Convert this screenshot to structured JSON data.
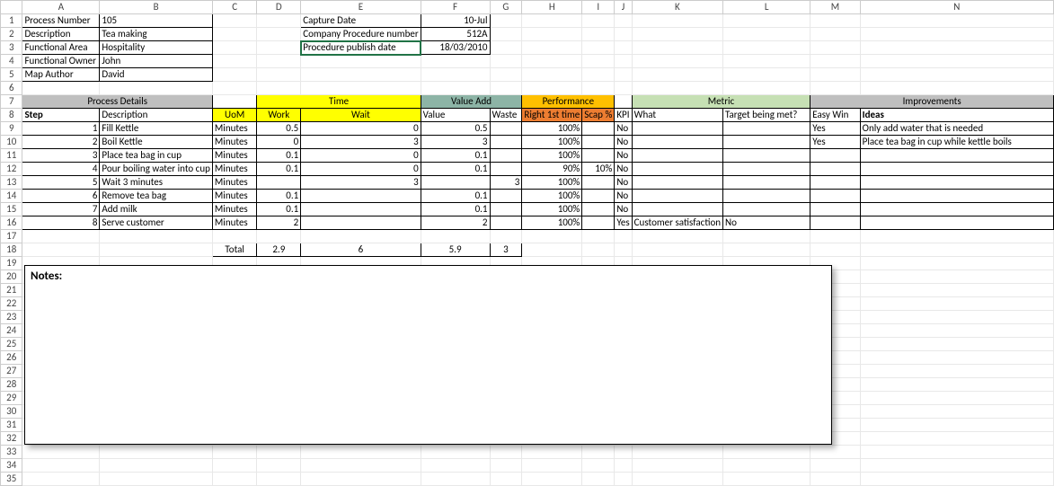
{
  "columns": [
    "A",
    "B",
    "C",
    "D",
    "E",
    "F",
    "G",
    "H",
    "I",
    "J",
    "K",
    "L",
    "M",
    "N"
  ],
  "rows": 35,
  "meta": {
    "process_number_label": "Process  Number",
    "process_number": "105",
    "description_label": "Description",
    "description": "Tea making",
    "functional_area_label": "Functional Area",
    "functional_area": "Hospitality",
    "functional_owner_label": "Functional Owner",
    "functional_owner": "John",
    "map_author_label": "Map Author",
    "map_author": "David",
    "capture_date_label": "Capture Date",
    "capture_date": "10-Jul",
    "company_proc_label": "Company Procedure number",
    "company_proc": "512A",
    "publish_label": "Procedure publish date",
    "publish": "18/03/2010"
  },
  "group_headers": {
    "process_details": "Process Details",
    "time": "Time",
    "value_add": "Value Add",
    "performance": "Performance",
    "metric": "Metric",
    "improvements": "Improvements"
  },
  "col_headers": {
    "step": "Step",
    "desc": "Description",
    "uom": "UoM",
    "work": "Work",
    "wait": "Wait",
    "value": "Value",
    "waste": "Waste",
    "right": "Right 1st time",
    "scap": "Scap %",
    "kpi": "KPI",
    "what": "What",
    "target": "Target being met?",
    "easy": "Easy Win",
    "ideas": "Ideas"
  },
  "steps": [
    {
      "n": "1",
      "desc": "Fill Kettle",
      "uom": "Minutes",
      "work": "0.5",
      "wait": "0",
      "value": "0.5",
      "waste": "",
      "right": "100%",
      "scap": "",
      "kpi": "No",
      "what": "",
      "target": "",
      "easy": "Yes",
      "ideas": "Only add water that is needed"
    },
    {
      "n": "2",
      "desc": "Boil Kettle",
      "uom": "Minutes",
      "work": "0",
      "wait": "3",
      "value": "3",
      "waste": "",
      "right": "100%",
      "scap": "",
      "kpi": "No",
      "what": "",
      "target": "",
      "easy": "Yes",
      "ideas": "Place tea bag in cup while kettle boils"
    },
    {
      "n": "3",
      "desc": "Place tea bag in cup",
      "uom": "Minutes",
      "work": "0.1",
      "wait": "0",
      "value": "0.1",
      "waste": "",
      "right": "100%",
      "scap": "",
      "kpi": "No",
      "what": "",
      "target": "",
      "easy": "",
      "ideas": ""
    },
    {
      "n": "4",
      "desc": "Pour boiling water into cup",
      "uom": "Minutes",
      "work": "0.1",
      "wait": "0",
      "value": "0.1",
      "waste": "",
      "right": "90%",
      "scap": "10%",
      "kpi": "No",
      "what": "",
      "target": "",
      "easy": "",
      "ideas": ""
    },
    {
      "n": "5",
      "desc": "Wait 3 minutes",
      "uom": "Minutes",
      "work": "",
      "wait": "3",
      "value": "",
      "waste": "3",
      "right": "100%",
      "scap": "",
      "kpi": "No",
      "what": "",
      "target": "",
      "easy": "",
      "ideas": ""
    },
    {
      "n": "6",
      "desc": "Remove tea bag",
      "uom": "Minutes",
      "work": "0.1",
      "wait": "",
      "value": "0.1",
      "waste": "",
      "right": "100%",
      "scap": "",
      "kpi": "No",
      "what": "",
      "target": "",
      "easy": "",
      "ideas": ""
    },
    {
      "n": "7",
      "desc": "Add milk",
      "uom": "Minutes",
      "work": "0.1",
      "wait": "",
      "value": "0.1",
      "waste": "",
      "right": "100%",
      "scap": "",
      "kpi": "No",
      "what": "",
      "target": "",
      "easy": "",
      "ideas": ""
    },
    {
      "n": "8",
      "desc": "Serve customer",
      "uom": "Minutes",
      "work": "2",
      "wait": "",
      "value": "2",
      "waste": "",
      "right": "100%",
      "scap": "",
      "kpi": "Yes",
      "what": "Customer satisfaction",
      "target": "No",
      "easy": "",
      "ideas": ""
    }
  ],
  "totals": {
    "label": "Total",
    "work": "2.9",
    "wait": "6",
    "value": "5.9",
    "waste": "3"
  },
  "notes_label": "Notes:"
}
